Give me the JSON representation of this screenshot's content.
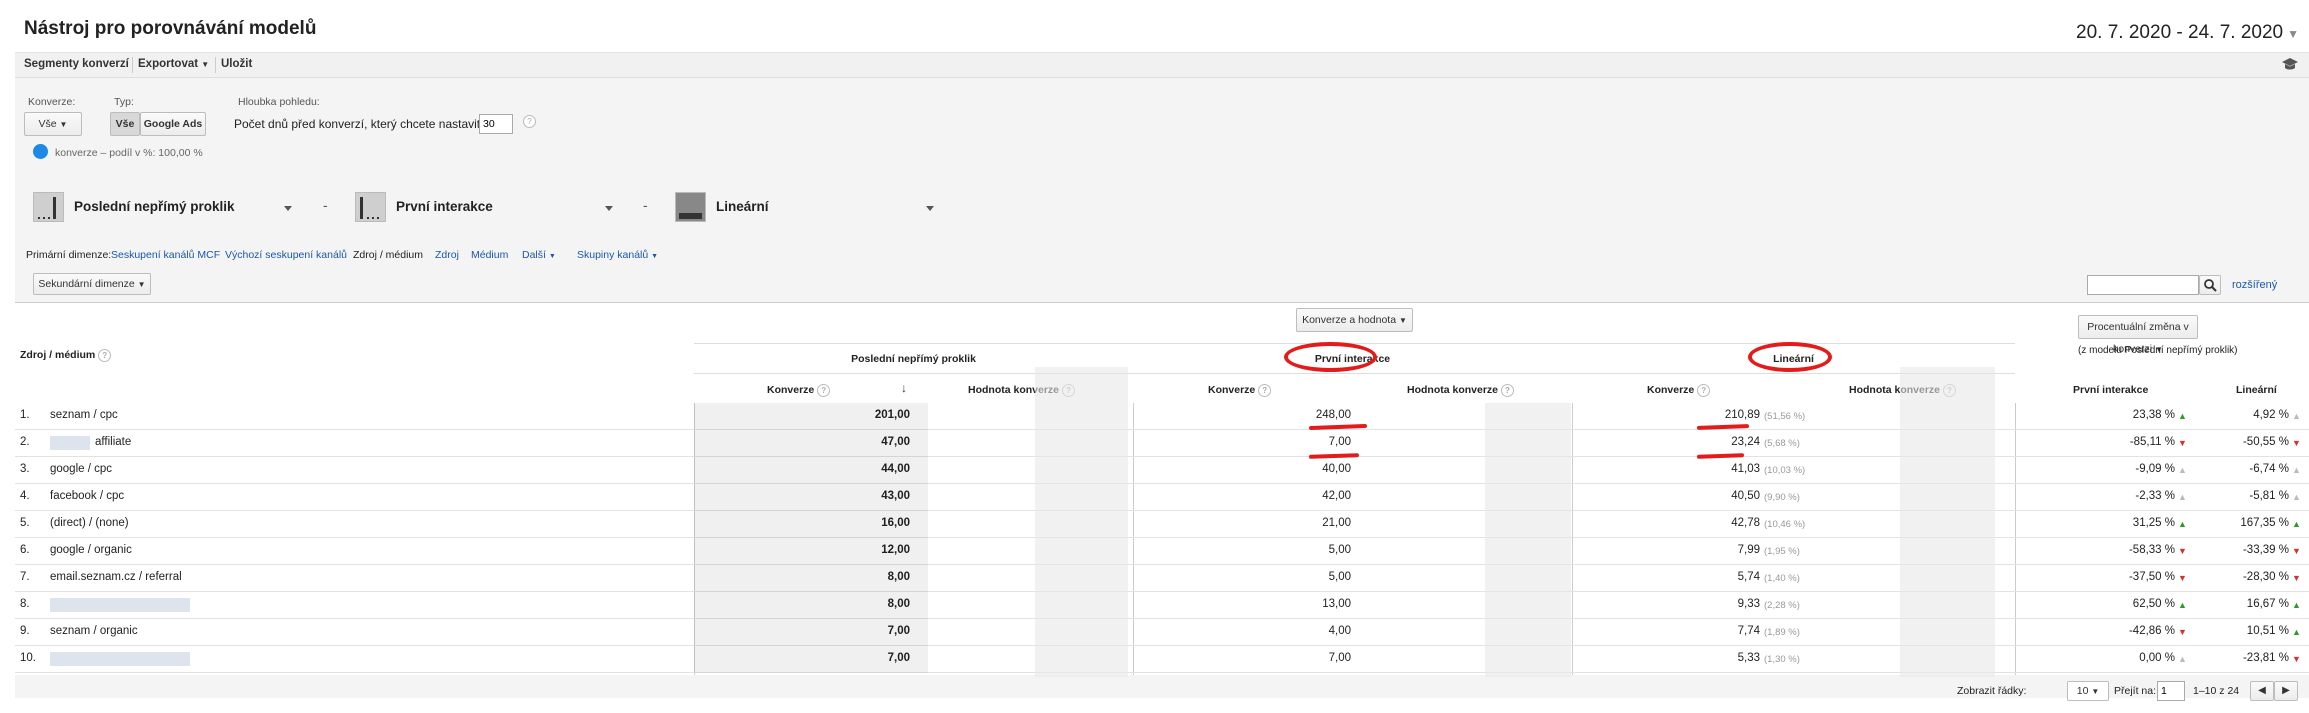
{
  "header": {
    "title": "Nástroj pro porovnávání modelů",
    "date_range": "20. 7. 2020 - 24. 7. 2020"
  },
  "toolbar": {
    "segments": "Segmenty konverzí",
    "export": "Exportovat",
    "save": "Uložit"
  },
  "filters": {
    "conversion_label": "Konverze:",
    "conversion_value": "Vše",
    "type_label": "Typ:",
    "type_all": "Vše",
    "type_ads": "Google Ads",
    "depth_label": "Hloubka pohledu:",
    "depth_text": "Počet dnů před konverzí, který chcete nastavit:",
    "depth_value": "30",
    "legend": "konverze – podíl v %: 100,00 %"
  },
  "models": [
    "Poslední nepřímý proklik",
    "První interakce",
    "Lineární"
  ],
  "dimensions": {
    "label": "Primární dimenze:",
    "items": [
      "Seskupení kanálů MCF",
      "Výchozí seskupení kanálů",
      "Zdroj / médium",
      "Zdroj",
      "Médium",
      "Další",
      "Skupiny kanálů"
    ]
  },
  "table_controls": {
    "secondary": "Sekundární dimenze",
    "advanced": "rozšířený"
  },
  "table": {
    "dim_header": "Zdroj / médium",
    "metric_select": "Konverze a hodnota",
    "change_select": "Procentuální změna v konverzi",
    "change_note": "(z modelu Poslední nepřímý proklik)",
    "model_headers": [
      "Poslední nepřímý proklik",
      "První interakce",
      "Lineární"
    ],
    "col_conv": "Konverze",
    "col_value": "Hodnota konverze",
    "col_first": "První interakce",
    "col_linear": "Lineární",
    "rows": [
      {
        "n": "1.",
        "src": "seznam / cpc",
        "last": "201,00",
        "first": "248,00",
        "lin": "210,89",
        "lin_pct": "(51,56 %)",
        "ch_first": "23,38 %",
        "ch_first_dir": "up",
        "ch_lin": "4,92 %",
        "ch_lin_dir": "n"
      },
      {
        "n": "2.",
        "src": "affiliate",
        "last": "47,00",
        "first": "7,00",
        "lin": "23,24",
        "lin_pct": "(5,68 %)",
        "ch_first": "-85,11 %",
        "ch_first_dir": "down",
        "ch_lin": "-50,55 %",
        "ch_lin_dir": "down"
      },
      {
        "n": "3.",
        "src": "google / cpc",
        "last": "44,00",
        "first": "40,00",
        "lin": "41,03",
        "lin_pct": "(10,03 %)",
        "ch_first": "-9,09 %",
        "ch_first_dir": "n",
        "ch_lin": "-6,74 %",
        "ch_lin_dir": "n"
      },
      {
        "n": "4.",
        "src": "facebook / cpc",
        "last": "43,00",
        "first": "42,00",
        "lin": "40,50",
        "lin_pct": "(9,90 %)",
        "ch_first": "-2,33 %",
        "ch_first_dir": "n",
        "ch_lin": "-5,81 %",
        "ch_lin_dir": "n"
      },
      {
        "n": "5.",
        "src": "(direct) / (none)",
        "last": "16,00",
        "first": "21,00",
        "lin": "42,78",
        "lin_pct": "(10,46 %)",
        "ch_first": "31,25 %",
        "ch_first_dir": "up",
        "ch_lin": "167,35 %",
        "ch_lin_dir": "up"
      },
      {
        "n": "6.",
        "src": "google / organic",
        "last": "12,00",
        "first": "5,00",
        "lin": "7,99",
        "lin_pct": "(1,95 %)",
        "ch_first": "-58,33 %",
        "ch_first_dir": "down",
        "ch_lin": "-33,39 %",
        "ch_lin_dir": "down"
      },
      {
        "n": "7.",
        "src": "email.seznam.cz / referral",
        "last": "8,00",
        "first": "5,00",
        "lin": "5,74",
        "lin_pct": "(1,40 %)",
        "ch_first": "-37,50 %",
        "ch_first_dir": "down",
        "ch_lin": "-28,30 %",
        "ch_lin_dir": "down"
      },
      {
        "n": "8.",
        "src": "",
        "last": "8,00",
        "first": "13,00",
        "lin": "9,33",
        "lin_pct": "(2,28 %)",
        "ch_first": "62,50 %",
        "ch_first_dir": "up",
        "ch_lin": "16,67 %",
        "ch_lin_dir": "up"
      },
      {
        "n": "9.",
        "src": "seznam / organic",
        "last": "7,00",
        "first": "4,00",
        "lin": "7,74",
        "lin_pct": "(1,89 %)",
        "ch_first": "-42,86 %",
        "ch_first_dir": "down",
        "ch_lin": "10,51 %",
        "ch_lin_dir": "up"
      },
      {
        "n": "10.",
        "src": "",
        "last": "7,00",
        "first": "7,00",
        "lin": "5,33",
        "lin_pct": "(1,30 %)",
        "ch_first": "0,00 %",
        "ch_first_dir": "n",
        "ch_lin": "-23,81 %",
        "ch_lin_dir": "down"
      }
    ]
  },
  "pagination": {
    "show_rows_label": "Zobrazit řádky:",
    "rows_value": "10",
    "goto_label": "Přejít na:",
    "goto_value": "1",
    "range": "1–10 z 24"
  },
  "colors": {
    "link": "#1a57b0",
    "annotation_red": "#e31b1b",
    "legend_blue": "#1e88e5"
  }
}
